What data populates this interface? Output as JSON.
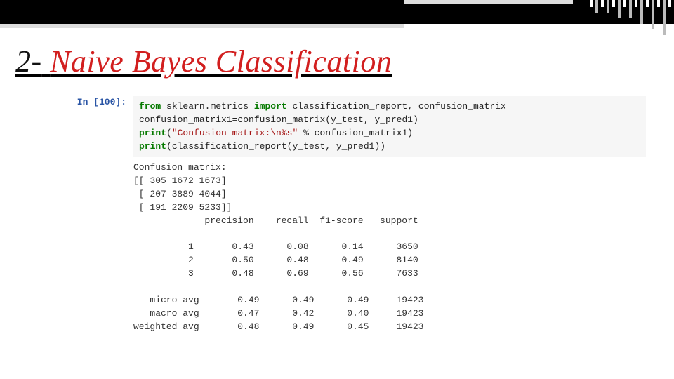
{
  "title": {
    "prefix": "2-",
    "main": "Naive Bayes Classification"
  },
  "prompt": "In [100]:",
  "code": {
    "l1_kw1": "from",
    "l1_mod": "sklearn.metrics",
    "l1_kw2": "import",
    "l1_rest": "classification_report, confusion_matrix",
    "l2": "confusion_matrix1=confusion_matrix(y_test, y_pred1)",
    "l3_kw": "print",
    "l3_open": "(",
    "l3_str": "\"Confusion matrix:\\n%s\"",
    "l3_rest": " % confusion_matrix1)",
    "l4_kw": "print",
    "l4_rest": "(classification_report(y_test, y_pred1))"
  },
  "output": {
    "header": "Confusion matrix:",
    "matrix_rows": [
      "[[ 305 1672 1673]",
      " [ 207 3889 4044]",
      " [ 191 2209 5233]]"
    ],
    "col_header": "             precision    recall  f1-score   support",
    "rows": [
      "          1       0.43      0.08      0.14      3650",
      "          2       0.50      0.48      0.49      8140",
      "          3       0.48      0.69      0.56      7633"
    ],
    "avg_rows": [
      "   micro avg       0.49      0.49      0.49     19423",
      "   macro avg       0.47      0.42      0.40     19423",
      "weighted avg       0.48      0.49      0.45     19423"
    ]
  },
  "chart_data": {
    "type": "table",
    "title": "Naive Bayes Classification report",
    "confusion_matrix": [
      [
        305,
        1672,
        1673
      ],
      [
        207,
        3889,
        4044
      ],
      [
        191,
        2209,
        5233
      ]
    ],
    "columns": [
      "precision",
      "recall",
      "f1-score",
      "support"
    ],
    "classes": {
      "1": {
        "precision": 0.43,
        "recall": 0.08,
        "f1-score": 0.14,
        "support": 3650
      },
      "2": {
        "precision": 0.5,
        "recall": 0.48,
        "f1-score": 0.49,
        "support": 8140
      },
      "3": {
        "precision": 0.48,
        "recall": 0.69,
        "f1-score": 0.56,
        "support": 7633
      }
    },
    "averages": {
      "micro avg": {
        "precision": 0.49,
        "recall": 0.49,
        "f1-score": 0.49,
        "support": 19423
      },
      "macro avg": {
        "precision": 0.47,
        "recall": 0.42,
        "f1-score": 0.4,
        "support": 19423
      },
      "weighted avg": {
        "precision": 0.48,
        "recall": 0.49,
        "f1-score": 0.45,
        "support": 19423
      }
    }
  }
}
